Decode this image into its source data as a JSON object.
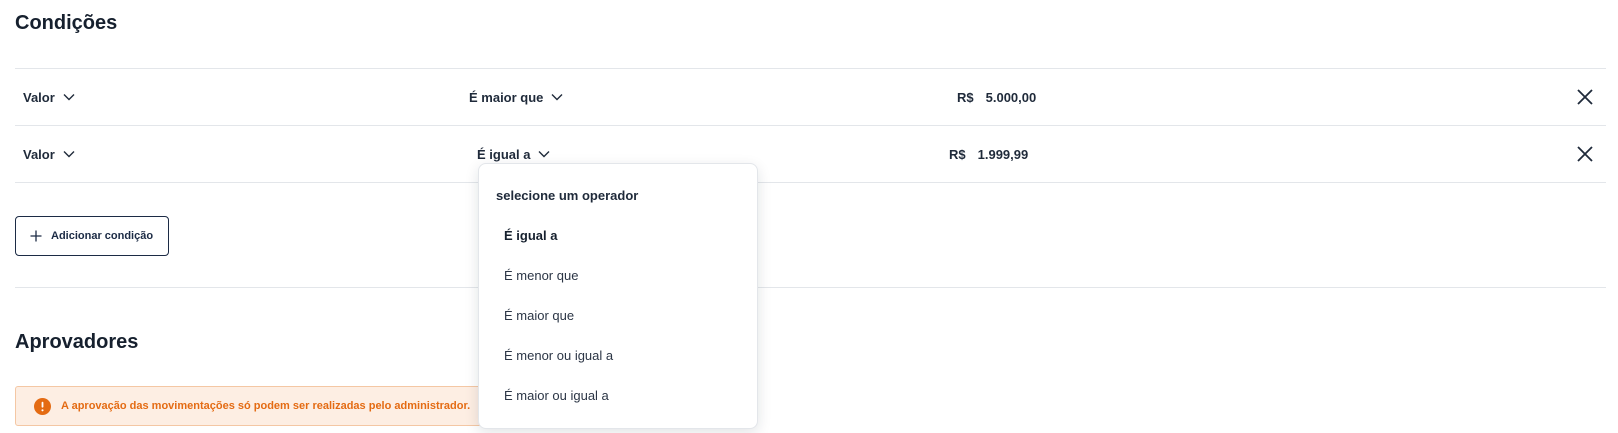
{
  "conditions_section": {
    "title": "Condições",
    "rows": [
      {
        "field": "Valor",
        "operator": "É maior que",
        "currency": "R$",
        "value": "5.000,00"
      },
      {
        "field": "Valor",
        "operator": "É igual a",
        "currency": "R$",
        "value": "1.999,99"
      }
    ],
    "add_button_label": "Adicionar condição"
  },
  "operator_dropdown": {
    "header": "selecione um operador",
    "options": [
      "É igual a",
      "É menor que",
      "É maior que",
      "É menor ou igual a",
      "É maior ou igual a"
    ],
    "selected": "É igual a"
  },
  "approvers_section": {
    "title": "Aprovadores",
    "alert_text": "A aprovação das movimentações só podem ser realizadas pelo administrador."
  },
  "colors": {
    "text_primary": "#1f2a3a",
    "divider": "#e3e6ea",
    "alert_bg": "#fdeee3",
    "alert_border": "#f4c7a4",
    "alert_text": "#e46b13",
    "button_border": "#1c2b45"
  },
  "icons": {
    "dropdown_chevron": "chevron-down-icon",
    "remove": "close-icon",
    "add": "plus-icon",
    "alert": "warning-icon"
  }
}
